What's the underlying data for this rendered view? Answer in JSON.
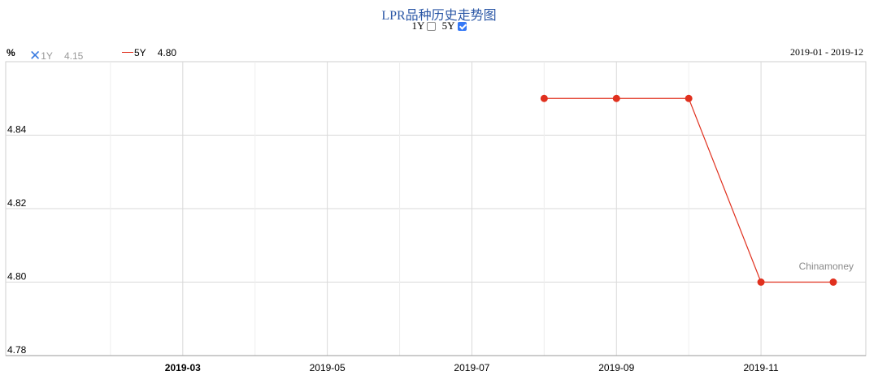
{
  "title": "LPR品种历史走势图",
  "toggles": [
    {
      "label": "1Y",
      "checked": false
    },
    {
      "label": "5Y",
      "checked": true
    }
  ],
  "unit": "%",
  "legend": [
    {
      "name": "1Y",
      "value": "4.15",
      "hidden": true,
      "icon": "x-icon"
    },
    {
      "name": "5Y",
      "value": "4.80",
      "hidden": false,
      "color": "#e0301e"
    }
  ],
  "date_range": "2019-01 - 2019-12",
  "watermark": "Chinamoney",
  "colors": {
    "series_5y": "#e0301e",
    "title": "#2b57a6",
    "grid": "#d9d9d9",
    "hidden_icon": "#3a7be0"
  },
  "chart_data": {
    "type": "line",
    "title": "LPR品种历史走势图",
    "ylabel": "%",
    "xlabel": "",
    "xlim": [
      "2019-01",
      "2019-12"
    ],
    "ylim": [
      4.78,
      4.86
    ],
    "y_ticks": [
      4.78,
      4.8,
      4.82,
      4.84
    ],
    "x_ticks": [
      "2019-03",
      "2019-05",
      "2019-07",
      "2019-09",
      "2019-11"
    ],
    "grid": true,
    "series": [
      {
        "name": "5Y",
        "color": "#e0301e",
        "x": [
          "2019-08",
          "2019-09",
          "2019-10",
          "2019-11",
          "2019-12"
        ],
        "y": [
          4.85,
          4.85,
          4.85,
          4.8,
          4.8
        ]
      }
    ]
  }
}
